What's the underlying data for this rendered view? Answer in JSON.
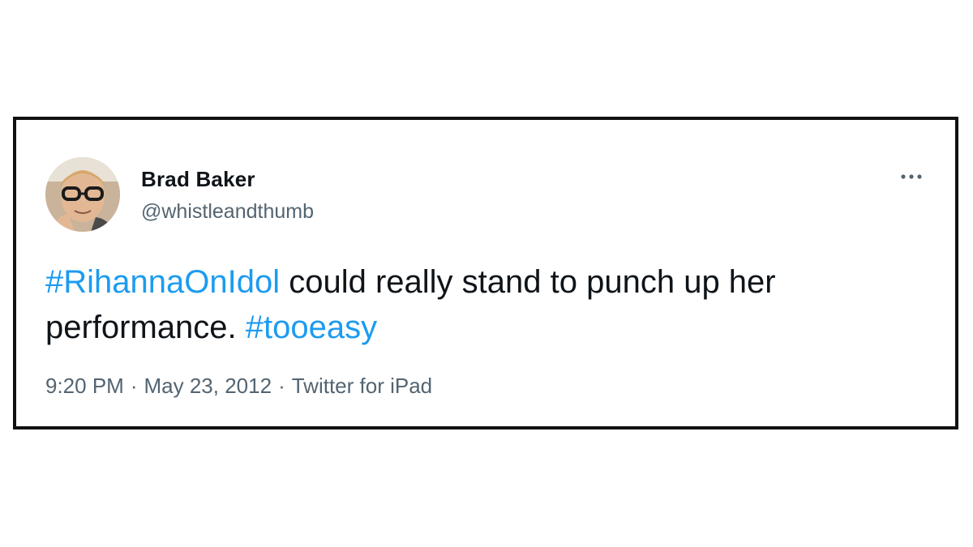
{
  "tweet": {
    "author": {
      "name": "Brad Baker",
      "handle": "@whistleandthumb"
    },
    "text": {
      "hashtag_1": "#RihannaOnIdol",
      "body": " could really stand to punch up her performance. ",
      "hashtag_2": "#tooeasy"
    },
    "meta": {
      "time": "9:20 PM",
      "separator": "·",
      "date": "May 23, 2012",
      "source": "Twitter for iPad"
    },
    "icons": {
      "more": "more-horizontal-icon",
      "avatar": "avatar-photo"
    },
    "colors": {
      "hashtag": "#1d9bf0",
      "text": "#0f1419",
      "secondary": "#536471",
      "border": "#111111"
    }
  }
}
